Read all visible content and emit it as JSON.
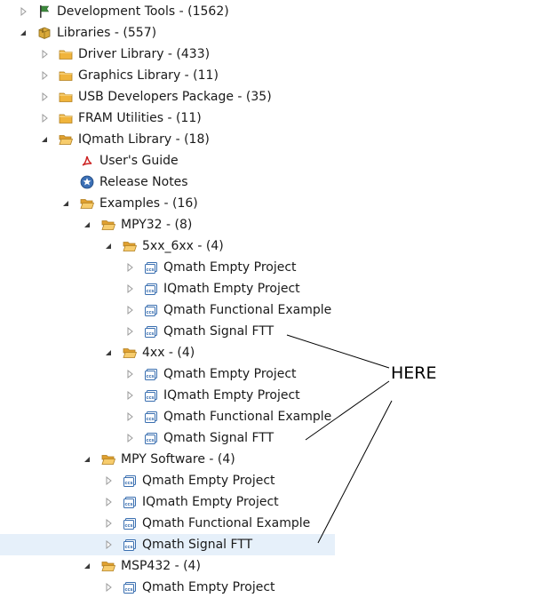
{
  "tree": {
    "items": [
      {
        "label": "Development Tools - (1562)",
        "icon": "plugin-flag-icon",
        "depth": 0,
        "twisty": "collapsed",
        "selected": false
      },
      {
        "label": "Libraries - (557)",
        "icon": "package-icon",
        "depth": 0,
        "twisty": "expanded",
        "selected": false
      },
      {
        "label": "Driver Library - (433)",
        "icon": "folder-icon",
        "depth": 1,
        "twisty": "collapsed",
        "selected": false
      },
      {
        "label": "Graphics Library - (11)",
        "icon": "folder-icon",
        "depth": 1,
        "twisty": "collapsed",
        "selected": false
      },
      {
        "label": "USB Developers Package - (35)",
        "icon": "folder-icon",
        "depth": 1,
        "twisty": "collapsed",
        "selected": false
      },
      {
        "label": "FRAM Utilities - (11)",
        "icon": "folder-icon",
        "depth": 1,
        "twisty": "collapsed",
        "selected": false
      },
      {
        "label": "IQmath Library - (18)",
        "icon": "folder-open-icon",
        "depth": 1,
        "twisty": "expanded",
        "selected": false
      },
      {
        "label": "User's Guide",
        "icon": "pdf-icon",
        "depth": 2,
        "twisty": "none",
        "selected": false
      },
      {
        "label": "Release Notes",
        "icon": "release-notes-icon",
        "depth": 2,
        "twisty": "none",
        "selected": false
      },
      {
        "label": "Examples - (16)",
        "icon": "folder-open-icon",
        "depth": 2,
        "twisty": "expanded",
        "selected": false
      },
      {
        "label": "MPY32 - (8)",
        "icon": "folder-open-icon",
        "depth": 3,
        "twisty": "expanded",
        "selected": false
      },
      {
        "label": "5xx_6xx - (4)",
        "icon": "folder-open-icon",
        "depth": 4,
        "twisty": "expanded",
        "selected": false
      },
      {
        "label": "Qmath Empty Project",
        "icon": "ccs-project-icon",
        "depth": 5,
        "twisty": "collapsed",
        "selected": false
      },
      {
        "label": "IQmath Empty Project",
        "icon": "ccs-project-icon",
        "depth": 5,
        "twisty": "collapsed",
        "selected": false
      },
      {
        "label": "Qmath Functional Example",
        "icon": "ccs-project-icon",
        "depth": 5,
        "twisty": "collapsed",
        "selected": false
      },
      {
        "label": "Qmath Signal FTT",
        "icon": "ccs-project-icon",
        "depth": 5,
        "twisty": "collapsed",
        "selected": false
      },
      {
        "label": "4xx - (4)",
        "icon": "folder-open-icon",
        "depth": 4,
        "twisty": "expanded",
        "selected": false
      },
      {
        "label": "Qmath Empty Project",
        "icon": "ccs-project-icon",
        "depth": 5,
        "twisty": "collapsed",
        "selected": false
      },
      {
        "label": "IQmath Empty Project",
        "icon": "ccs-project-icon",
        "depth": 5,
        "twisty": "collapsed",
        "selected": false
      },
      {
        "label": "Qmath Functional Example",
        "icon": "ccs-project-icon",
        "depth": 5,
        "twisty": "collapsed",
        "selected": false
      },
      {
        "label": "Qmath Signal FTT",
        "icon": "ccs-project-icon",
        "depth": 5,
        "twisty": "collapsed",
        "selected": false
      },
      {
        "label": "MPY Software - (4)",
        "icon": "folder-open-icon",
        "depth": 3,
        "twisty": "expanded",
        "selected": false
      },
      {
        "label": "Qmath Empty Project",
        "icon": "ccs-project-icon",
        "depth": 4,
        "twisty": "collapsed",
        "selected": false
      },
      {
        "label": "IQmath Empty Project",
        "icon": "ccs-project-icon",
        "depth": 4,
        "twisty": "collapsed",
        "selected": false
      },
      {
        "label": "Qmath Functional Example",
        "icon": "ccs-project-icon",
        "depth": 4,
        "twisty": "collapsed",
        "selected": false
      },
      {
        "label": "Qmath Signal FTT",
        "icon": "ccs-project-icon",
        "depth": 4,
        "twisty": "collapsed",
        "selected": true
      },
      {
        "label": "MSP432 - (4)",
        "icon": "folder-open-icon",
        "depth": 3,
        "twisty": "expanded",
        "selected": false
      },
      {
        "label": "Qmath Empty Project",
        "icon": "ccs-project-icon",
        "depth": 4,
        "twisty": "collapsed",
        "selected": false
      }
    ]
  },
  "annotation": {
    "text": "HERE",
    "color": "#000000"
  },
  "colors": {
    "selection": "#e6f0fa",
    "folder": "#f0b43c",
    "twisty_expanded": "#3a3a3a",
    "twisty_collapsed": "#9a9a9a",
    "ccs_icon": "#3a6fb0",
    "pdf_icon": "#cc2222"
  }
}
